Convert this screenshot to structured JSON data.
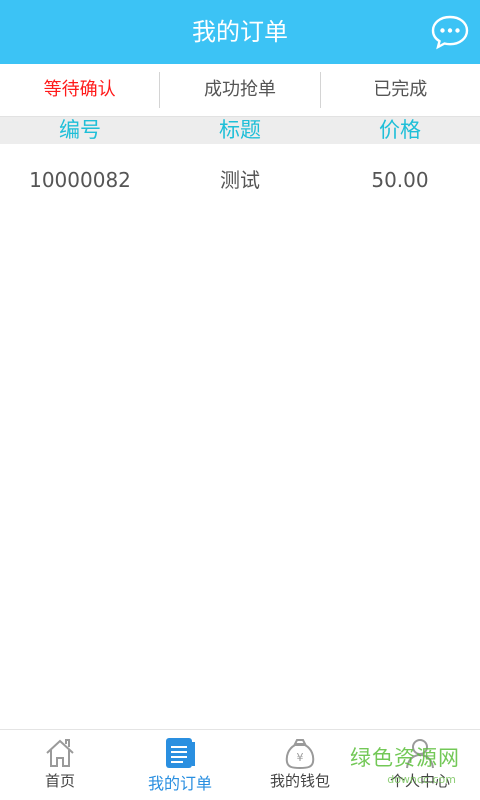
{
  "header": {
    "title": "我的订单",
    "chat_icon": "chat-bubble-icon"
  },
  "tabs": [
    {
      "label": "等待确认",
      "active": true
    },
    {
      "label": "成功抢单",
      "active": false
    },
    {
      "label": "已完成",
      "active": false
    }
  ],
  "table": {
    "headers": [
      "编号",
      "标题",
      "价格"
    ],
    "rows": [
      [
        "10000082",
        "测试",
        "50.00"
      ]
    ]
  },
  "tabbar": [
    {
      "label": "首页",
      "icon": "home-icon",
      "active": false
    },
    {
      "label": "我的订单",
      "icon": "order-list-icon",
      "active": true
    },
    {
      "label": "我的钱包",
      "icon": "money-bag-icon",
      "active": false
    },
    {
      "label": "个人中心",
      "icon": "person-icon",
      "active": false
    }
  ],
  "watermark": {
    "text": "绿色资源网",
    "url": "downcc.com"
  },
  "colors": {
    "header_bg": "#3cc3f5",
    "active_tab": "#ff1a1a",
    "column_header": "#1fbfd8",
    "tabbar_active": "#2a8fe0"
  }
}
